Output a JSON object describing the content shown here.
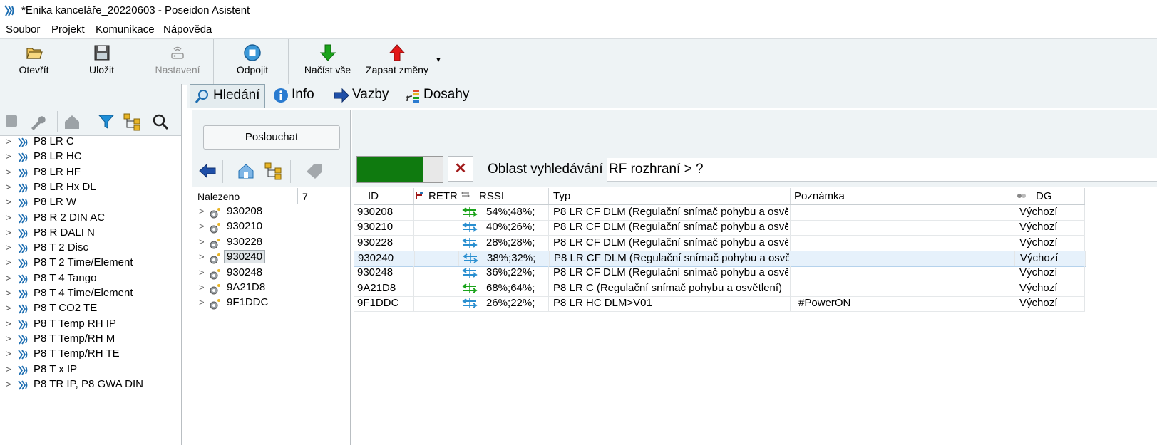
{
  "window": {
    "title": "*Enika kanceláře_20220603 - Poseidon Asistent"
  },
  "menu": [
    "Soubor",
    "Projekt",
    "Komunikace",
    "Nápověda"
  ],
  "toolbar": {
    "open": "Otevřít",
    "save": "Uložit",
    "settings": "Nastavení",
    "disconnect": "Odpojit",
    "read_all": "Načíst vše",
    "write_changes": "Zapsat změny"
  },
  "tree": [
    "P8 LR C",
    "P8 LR HC",
    "P8 LR HF",
    "P8 LR Hx DL",
    "P8 LR W",
    "P8 R 2 DIN AC",
    "P8 R DALI N",
    "P8 T 2 Disc",
    "P8 T 2 Time/Element",
    "P8 T 4 Tango",
    "P8 T 4 Time/Element",
    "P8 T CO2 TE",
    "P8 T Temp RH IP",
    "P8 T Temp/RH M",
    "P8 T Temp/RH TE",
    "P8 T x IP",
    "P8 TR IP, P8 GWA DIN"
  ],
  "tabs": [
    "Hledání",
    "Info",
    "Vazby",
    "Dosahy"
  ],
  "search": {
    "listen_label": "Poslouchat",
    "found_label": "Nalezeno",
    "found_count": "7",
    "progress_fraction": 0.77,
    "area_label": "Oblast vyhledávání",
    "area_value": "RF rozhraní > ?",
    "found_items": [
      "930208",
      "930210",
      "930228",
      "930240",
      "930248",
      "9A21D8",
      "9F1DDC"
    ],
    "selected_index": 3
  },
  "table": {
    "columns": [
      "ID",
      "RETR",
      "RSSI",
      "Typ",
      "Poznámka",
      "DG"
    ],
    "rows": [
      {
        "id": "930208",
        "retr": "",
        "rssi": "54%;48%;",
        "typ": "P8 LR CF DLM  (Regulační snímač pohybu a osvě",
        "note": "",
        "dg": "Výchozí",
        "signal": "strong"
      },
      {
        "id": "930210",
        "retr": "",
        "rssi": "40%;26%;",
        "typ": "P8 LR CF DLM  (Regulační snímač pohybu a osvě",
        "note": "",
        "dg": "Výchozí",
        "signal": "medium"
      },
      {
        "id": "930228",
        "retr": "",
        "rssi": "28%;28%;",
        "typ": "P8 LR CF DLM  (Regulační snímač pohybu a osvě",
        "note": "",
        "dg": "Výchozí",
        "signal": "medium"
      },
      {
        "id": "930240",
        "retr": "",
        "rssi": "38%;32%;",
        "typ": "P8 LR CF DLM  (Regulační snímač pohybu a osvě",
        "note": "",
        "dg": "Výchozí",
        "signal": "medium"
      },
      {
        "id": "930248",
        "retr": "",
        "rssi": "36%;22%;",
        "typ": "P8 LR CF DLM  (Regulační snímač pohybu a osvě",
        "note": "",
        "dg": "Výchozí",
        "signal": "medium"
      },
      {
        "id": "9A21D8",
        "retr": "",
        "rssi": "68%;64%;",
        "typ": "P8 LR C  (Regulační snímač pohybu a osvětlení)",
        "note": "",
        "dg": "Výchozí",
        "signal": "strong"
      },
      {
        "id": "9F1DDC",
        "retr": "",
        "rssi": "26%;22%;",
        "typ": "P8 LR HC DLM>V01",
        "note": "#PowerON",
        "dg": "Výchozí",
        "signal": "medium"
      }
    ],
    "selected_index": 3
  }
}
